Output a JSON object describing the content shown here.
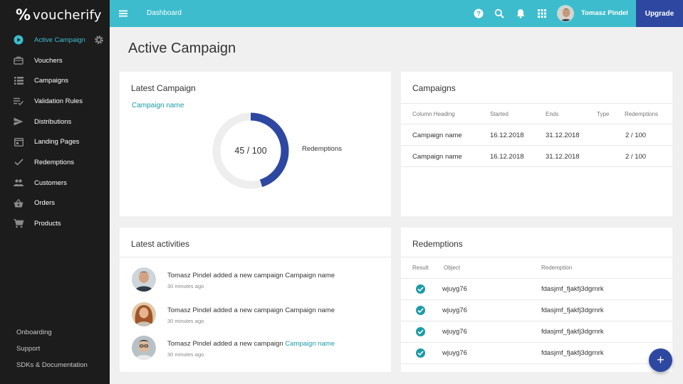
{
  "app": {
    "brand": "voucherify",
    "brand_mark": "%"
  },
  "sidebar": {
    "items": [
      {
        "label": "Active Campaign",
        "icon": "play-circle-icon",
        "active": true
      },
      {
        "label": "Vouchers",
        "icon": "voucher-icon"
      },
      {
        "label": "Campaigns",
        "icon": "list-icon"
      },
      {
        "label": "Validation Rules",
        "icon": "rules-icon"
      },
      {
        "label": "Distributions",
        "icon": "send-icon"
      },
      {
        "label": "Landing Pages",
        "icon": "landing-page-icon"
      },
      {
        "label": "Redemptions",
        "icon": "check-icon"
      },
      {
        "label": "Customers",
        "icon": "people-icon"
      },
      {
        "label": "Orders",
        "icon": "basket-icon"
      },
      {
        "label": "Products",
        "icon": "cart-icon"
      }
    ],
    "bottom_links": [
      "Onboarding",
      "Support",
      "SDKs & Documentation"
    ]
  },
  "topbar": {
    "breadcrumb": "Dashboard",
    "user_name": "Tomasz Pindel",
    "upgrade_label": "Upgrade"
  },
  "page": {
    "title": "Active Campaign"
  },
  "latest_campaign": {
    "title": "Latest Campaign",
    "campaign_link": "Campaign name",
    "donut_label": "45 / 100",
    "redeemed": 45,
    "total": 100,
    "legend": "Redemptions"
  },
  "campaigns": {
    "title": "Campaigns",
    "columns": [
      "Column Heading",
      "Started",
      "Ends",
      "Type",
      "Redemptions"
    ],
    "rows": [
      {
        "name": "Campaign name",
        "started": "16.12.2018",
        "ends": "31.12.2018",
        "type": "",
        "redemptions": "2 / 100"
      },
      {
        "name": "Campaign name",
        "started": "16.12.2018",
        "ends": "31.12.2018",
        "type": "",
        "redemptions": "2 / 100"
      }
    ]
  },
  "activities": {
    "title": "Latest activities",
    "items": [
      {
        "text": "Tomasz Pindel added a new campaign Campaign name",
        "link": "",
        "time": "30 minutes ago"
      },
      {
        "text": "Tomasz Pindel added a new campaign Campaign name",
        "link": "",
        "time": "30 minutes ago"
      },
      {
        "text": "Tomasz Pindel added a new campaign ",
        "link": "Campaign name",
        "time": "30 minutes ago"
      }
    ]
  },
  "redemptions": {
    "title": "Redemptions",
    "columns": [
      "Result",
      "Object",
      "Redemption"
    ],
    "rows": [
      {
        "object": "wjuyg76",
        "redemption": "fdasjmf_fjakfj3dgrnrk"
      },
      {
        "object": "wjuyg76",
        "redemption": "fdasjmf_fjakfj3dgrnrk"
      },
      {
        "object": "wjuyg76",
        "redemption": "fdasjmf_fjakfj3dgrnrk"
      },
      {
        "object": "wjuyg76",
        "redemption": "fdasjmf_fjakfj3dgrnrk"
      }
    ]
  },
  "fab": {
    "label": "+"
  },
  "colors": {
    "accent": "#3dbccd",
    "link": "#1c9ba8",
    "primary": "#2e48a1",
    "sidebar": "#1c1c1c"
  }
}
